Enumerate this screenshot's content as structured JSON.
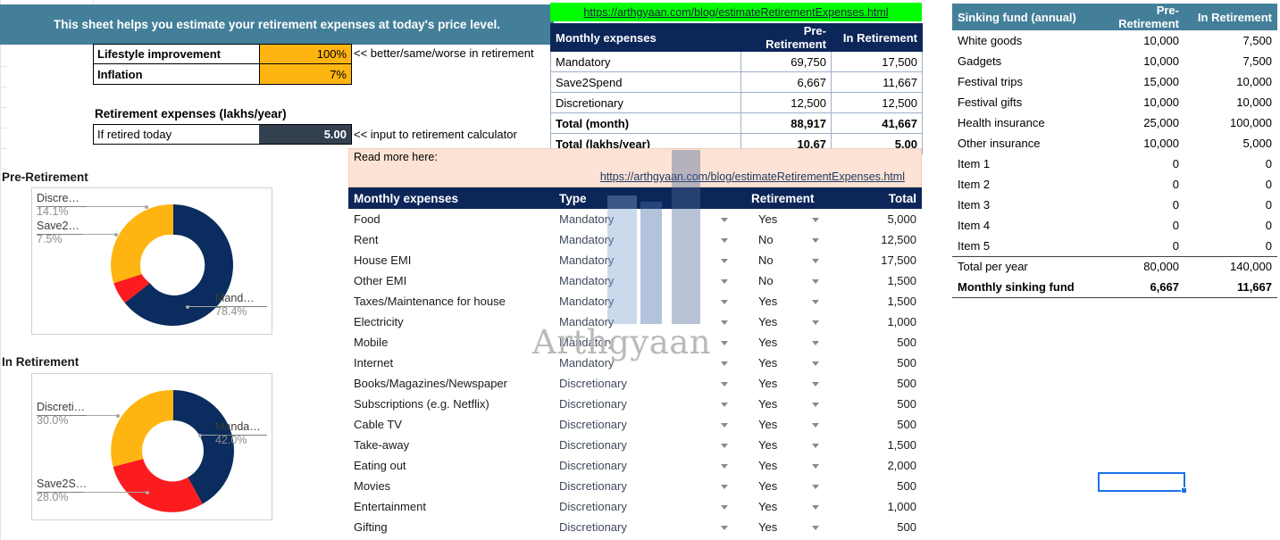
{
  "banner": {
    "text": "This sheet helps you estimate your retirement expenses at today's price level."
  },
  "assumptions": {
    "rows": [
      {
        "label": "Lifestyle improvement",
        "value": "100%"
      },
      {
        "label": "Inflation",
        "value": "7%"
      }
    ],
    "note": "<< better/same/worse in retirement"
  },
  "retirement_expenses": {
    "title": "Retirement expenses (lakhs/year)",
    "label": "If retired today",
    "value": "5.00",
    "note": "<< input to retirement calculator"
  },
  "link": {
    "url_text": "https://arthgyaan.com/blog/estimateRetirementExpenses.html",
    "read_more_label": "Read more here:"
  },
  "summary_table": {
    "headers": [
      "Monthly expenses",
      "Pre-Retirement",
      "In Retirement"
    ],
    "rows": [
      {
        "label": "Mandatory",
        "pre": "69,750",
        "post": "17,500",
        "bold": false
      },
      {
        "label": "Save2Spend",
        "pre": "6,667",
        "post": "11,667",
        "bold": false
      },
      {
        "label": "Discretionary",
        "pre": "12,500",
        "post": "12,500",
        "bold": false
      },
      {
        "label": "Total (month)",
        "pre": "88,917",
        "post": "41,667",
        "bold": true
      },
      {
        "label": "Total (lakhs/year)",
        "pre": "10.67",
        "post": "5.00",
        "bold": true
      }
    ]
  },
  "expenses_table": {
    "headers": [
      "Monthly expenses",
      "Type",
      "Retirement",
      "Total"
    ],
    "rows": [
      {
        "name": "Food",
        "type": "Mandatory",
        "retirement": "Yes",
        "total": "5,000"
      },
      {
        "name": "Rent",
        "type": "Mandatory",
        "retirement": "No",
        "total": "12,500"
      },
      {
        "name": "House EMI",
        "type": "Mandatory",
        "retirement": "No",
        "total": "17,500"
      },
      {
        "name": "Other EMI",
        "type": "Mandatory",
        "retirement": "No",
        "total": "1,500"
      },
      {
        "name": "Taxes/Maintenance for house",
        "type": "Mandatory",
        "retirement": "Yes",
        "total": "1,500"
      },
      {
        "name": "Electricity",
        "type": "Mandatory",
        "retirement": "Yes",
        "total": "1,000"
      },
      {
        "name": "Mobile",
        "type": "Mandatory",
        "retirement": "Yes",
        "total": "500"
      },
      {
        "name": "Internet",
        "type": "Mandatory",
        "retirement": "Yes",
        "total": "500"
      },
      {
        "name": "Books/Magazines/Newspaper",
        "type": "Discretionary",
        "retirement": "Yes",
        "total": "500"
      },
      {
        "name": "Subscriptions (e.g. Netflix)",
        "type": "Discretionary",
        "retirement": "Yes",
        "total": "500"
      },
      {
        "name": "Cable TV",
        "type": "Discretionary",
        "retirement": "Yes",
        "total": "500"
      },
      {
        "name": "Take-away",
        "type": "Discretionary",
        "retirement": "Yes",
        "total": "1,500"
      },
      {
        "name": "Eating out",
        "type": "Discretionary",
        "retirement": "Yes",
        "total": "2,000"
      },
      {
        "name": "Movies",
        "type": "Discretionary",
        "retirement": "Yes",
        "total": "500"
      },
      {
        "name": "Entertainment",
        "type": "Discretionary",
        "retirement": "Yes",
        "total": "1,000"
      },
      {
        "name": "Gifting",
        "type": "Discretionary",
        "retirement": "Yes",
        "total": "500"
      }
    ]
  },
  "sinking_fund": {
    "headers": [
      "Sinking fund (annual)",
      "Pre-Retirement",
      "In Retirement"
    ],
    "rows": [
      {
        "label": "White goods",
        "pre": "10,000",
        "post": "7,500"
      },
      {
        "label": "Gadgets",
        "pre": "10,000",
        "post": "7,500"
      },
      {
        "label": "Festival trips",
        "pre": "15,000",
        "post": "10,000"
      },
      {
        "label": "Festival gifts",
        "pre": "10,000",
        "post": "10,000"
      },
      {
        "label": "Health insurance",
        "pre": "25,000",
        "post": "100,000"
      },
      {
        "label": "Other insurance",
        "pre": "10,000",
        "post": "5,000"
      },
      {
        "label": "Item 1",
        "pre": "0",
        "post": "0"
      },
      {
        "label": "Item 2",
        "pre": "0",
        "post": "0"
      },
      {
        "label": "Item 3",
        "pre": "0",
        "post": "0"
      },
      {
        "label": "Item 4",
        "pre": "0",
        "post": "0"
      },
      {
        "label": "Item 5",
        "pre": "0",
        "post": "0"
      }
    ],
    "total_per_year": {
      "label": "Total per year",
      "pre": "80,000",
      "post": "140,000"
    },
    "monthly": {
      "label": "Monthly sinking fund",
      "pre": "6,667",
      "post": "11,667"
    }
  },
  "watermark": {
    "text": "Arthgyaan"
  },
  "colors": {
    "banner_teal": "#447f99",
    "header_navy": "#0d2659",
    "input_orange": "#ffb511",
    "output_dark": "#33404f",
    "link_green": "#00ff00",
    "readmore_peach": "#fce3d5",
    "series_mandatory": "#0a2c5e",
    "series_save2spend": "#fc1c20",
    "series_discretionary": "#ffb511",
    "selection_blue": "#1b72e8"
  },
  "chart_data": [
    {
      "type": "pie",
      "title": "Pre-Retirement",
      "labels": [
        "Mandatory",
        "Save2Spend",
        "Discretionary"
      ],
      "display_labels": [
        "Mand…",
        "Save2…",
        "Discre…"
      ],
      "values": [
        78.4,
        7.5,
        14.1
      ],
      "value_labels": [
        "78.4%",
        "7.5%",
        "14.1%"
      ],
      "colors": [
        "#0a2c5e",
        "#fc1c20",
        "#ffb511"
      ],
      "donut": true,
      "legend": "none"
    },
    {
      "type": "pie",
      "title": "In Retirement",
      "labels": [
        "Mandatory",
        "Save2Spend",
        "Discretionary"
      ],
      "display_labels": [
        "Manda…",
        "Save2S…",
        "Discreti…"
      ],
      "values": [
        42.0,
        28.0,
        30.0
      ],
      "value_labels": [
        "42.0%",
        "28.0%",
        "30.0%"
      ],
      "colors": [
        "#0a2c5e",
        "#fc1c20",
        "#ffb511"
      ],
      "donut": true,
      "legend": "none"
    }
  ]
}
